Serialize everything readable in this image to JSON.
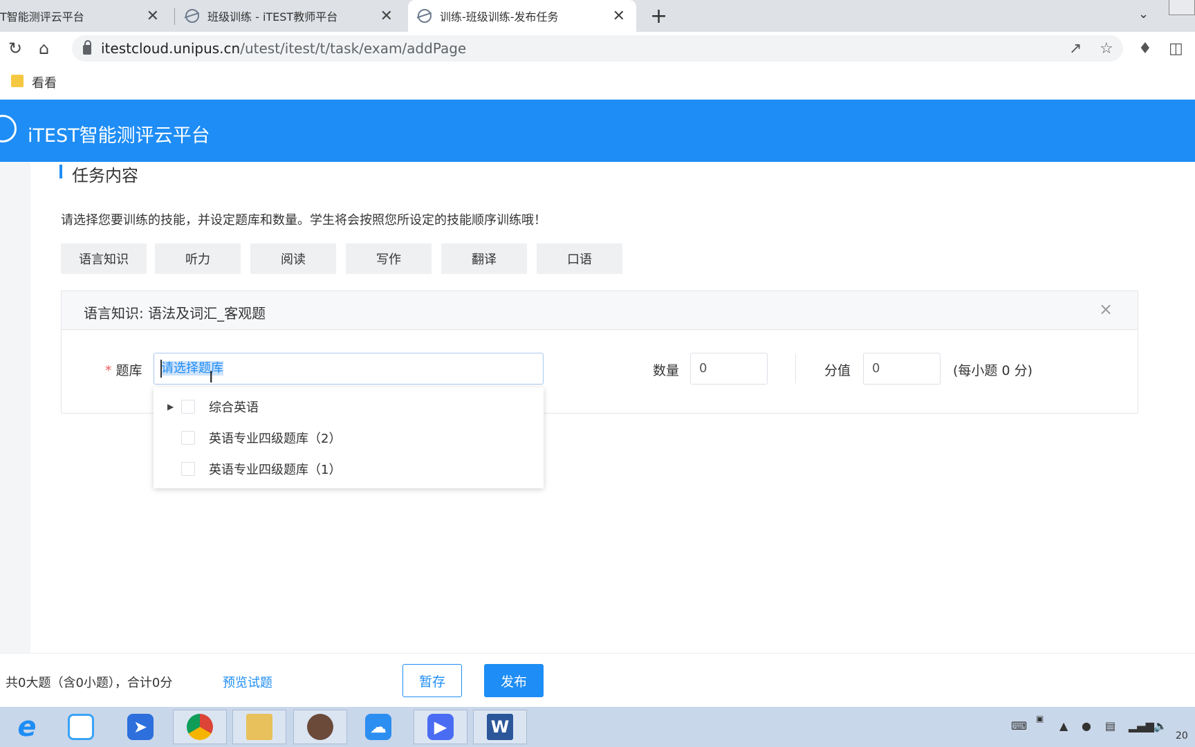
{
  "browser": {
    "tabs": [
      {
        "title": "T智能测评云平台"
      },
      {
        "title": "班级训练 - iTEST教师平台"
      },
      {
        "title": "训练-班级训练-发布任务"
      }
    ],
    "new_tab_symbol": "+",
    "close_symbol": "✕",
    "url_domain": "itestcloud.unipus.cn",
    "url_path": "/utest/itest/t/task/exam/addPage",
    "bookmark": "看看"
  },
  "app": {
    "name": "iTEST智能测评云平台",
    "brand_color": "#1e8df5"
  },
  "task": {
    "section_title": "任务内容",
    "instruction": "请选择您要训练的技能，并设定题库和数量。学生将会按照您所设定的技能顺序训练哦！",
    "skills": [
      "语言知识",
      "听力",
      "阅读",
      "写作",
      "翻译",
      "口语"
    ],
    "panel_title": "语言知识: 语法及词汇_客观题",
    "panel_close": "×",
    "bank_required_mark": "*",
    "bank_label": "题库",
    "bank_placeholder": "请选择题库",
    "quantity_label": "数量",
    "quantity_value": "0",
    "score_label": "分值",
    "score_value": "0",
    "per_item_note": "(每小题 0 分)",
    "bank_options": [
      {
        "label": "综合英语",
        "expandable": true
      },
      {
        "label": "英语专业四级题库（2）",
        "expandable": false
      },
      {
        "label": "英语专业四级题库（1）",
        "expandable": false
      }
    ]
  },
  "footer": {
    "summary": "共0大题（含0小题），合计0分",
    "preview": "预览试题",
    "save": "暂存",
    "publish": "发布"
  },
  "taskbar": {
    "apps": [
      "ie-icon",
      "baidu-netdisk-icon",
      "feishu-icon",
      "chrome-icon",
      "file-explorer-icon",
      "photo-icon",
      "cloud-meeting-icon",
      "video-player-icon",
      "word-icon"
    ],
    "word_letter": "W",
    "clock_fragment": "20"
  }
}
